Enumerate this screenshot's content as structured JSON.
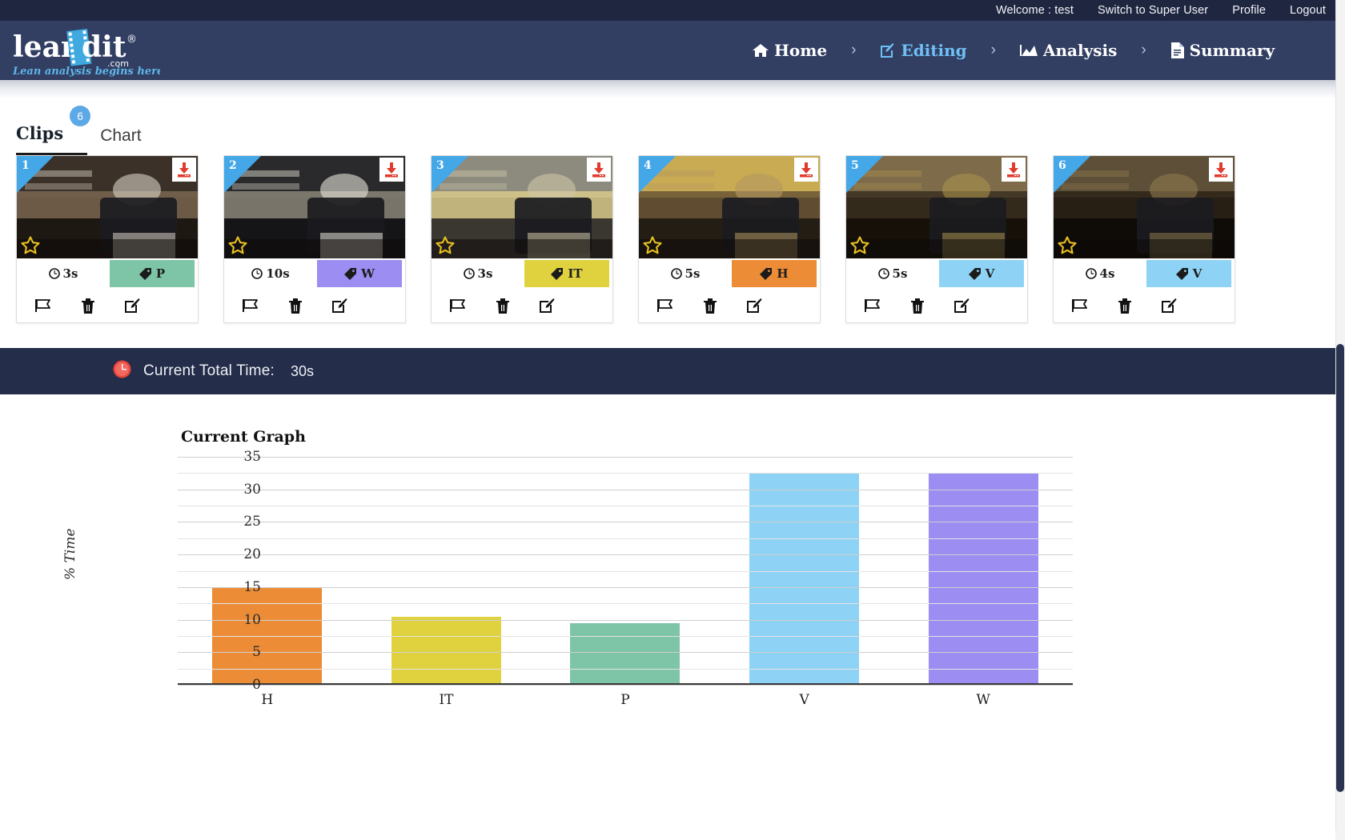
{
  "utility_bar": {
    "welcome": "Welcome : test",
    "switch_user": "Switch to Super User",
    "profile": "Profile",
    "logout": "Logout"
  },
  "brand": {
    "name": "leanEdit",
    "suffix": ".com",
    "tagline": "Lean analysis begins here"
  },
  "nav": {
    "items": [
      {
        "label": "Home",
        "icon": "home-icon",
        "active": false
      },
      {
        "label": "Editing",
        "icon": "edit-square-icon",
        "active": true
      },
      {
        "label": "Analysis",
        "icon": "chart-area-icon",
        "active": false
      },
      {
        "label": "Summary",
        "icon": "document-icon",
        "active": false
      }
    ],
    "separator": "›"
  },
  "tabs": [
    {
      "label": "Clips",
      "badge": "6",
      "active": true
    },
    {
      "label": "Chart",
      "badge": "",
      "active": false
    }
  ],
  "clips": [
    {
      "number": "1",
      "duration": "3s",
      "tag": "P",
      "tag_color": "#7ec4a6",
      "thumb_desc": "worker-at-bakery-rack"
    },
    {
      "number": "2",
      "duration": "10s",
      "tag": "W",
      "tag_color": "#9b8df2",
      "thumb_desc": "worker-carrying-dough-tray"
    },
    {
      "number": "3",
      "duration": "3s",
      "tag": "IT",
      "tag_color": "#e0d23f",
      "thumb_desc": "oven-tray-of-rolls"
    },
    {
      "number": "4",
      "duration": "5s",
      "tag": "H",
      "tag_color": "#ec8c36",
      "thumb_desc": "worker-at-oven-front"
    },
    {
      "number": "5",
      "duration": "5s",
      "tag": "V",
      "tag_color": "#8ed3f5",
      "thumb_desc": "worker-loading-oven"
    },
    {
      "number": "6",
      "duration": "4s",
      "tag": "V",
      "tag_color": "#8ed3f5",
      "thumb_desc": "worker-at-counter-side"
    }
  ],
  "clip_actions": [
    {
      "name": "flag-icon",
      "label": "Flag"
    },
    {
      "name": "trash-icon",
      "label": "Delete"
    },
    {
      "name": "edit-icon",
      "label": "Edit"
    }
  ],
  "clip_badges": {
    "download": "download-icon",
    "favorite": "star-icon"
  },
  "total_time": {
    "icon": "clock-icon",
    "label": "Current Total Time:",
    "value": "30s"
  },
  "chart_data": {
    "type": "bar",
    "title": "Current Graph",
    "xlabel": "",
    "ylabel": "% Time",
    "categories": [
      "H",
      "IT",
      "P",
      "V",
      "W"
    ],
    "values": [
      15,
      10.5,
      9.5,
      32.5,
      32.5
    ],
    "colors": [
      "#ec8c36",
      "#e0d23f",
      "#7ec4a6",
      "#8ed3f5",
      "#9b8df2"
    ],
    "ylim": [
      0,
      35
    ],
    "yticks": [
      0,
      5,
      10,
      15,
      20,
      25,
      30,
      35
    ],
    "minor_tick_step": 2.5,
    "grid": true,
    "legend": "none"
  }
}
